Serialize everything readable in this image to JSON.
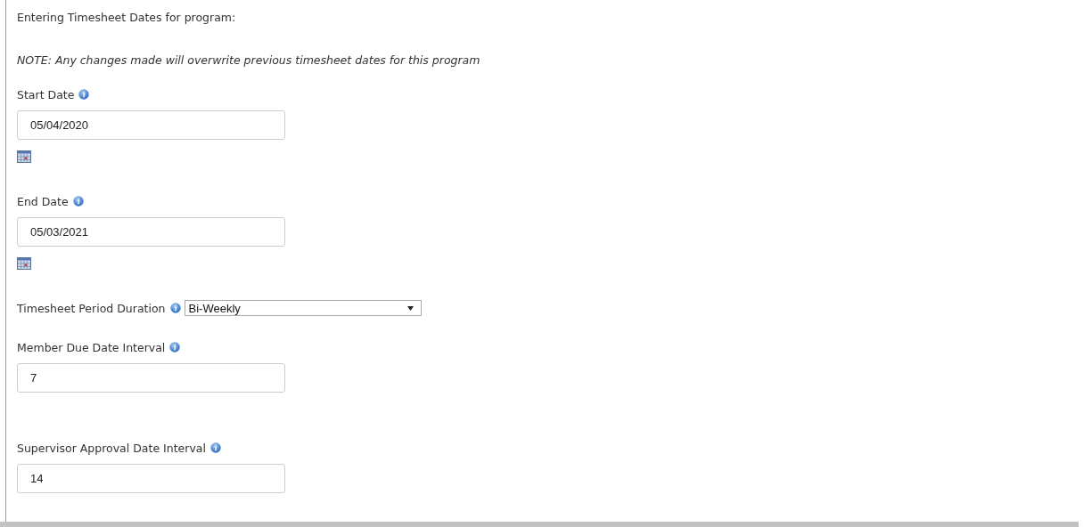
{
  "heading": "Entering Timesheet Dates for program:",
  "note": "NOTE: Any changes made will overwrite previous timesheet dates for this program",
  "fields": [
    {
      "kind": "date",
      "label": "Start Date",
      "value": "05/04/2020"
    },
    {
      "kind": "date",
      "label": "End Date",
      "value": "05/03/2021"
    },
    {
      "kind": "select",
      "label": "Timesheet Period Duration",
      "value": "Bi-Weekly"
    },
    {
      "kind": "number",
      "label": "Member Due Date Interval",
      "value": "7"
    },
    {
      "kind": "number",
      "label": "Supervisor Approval Date Interval",
      "value": "14"
    }
  ]
}
